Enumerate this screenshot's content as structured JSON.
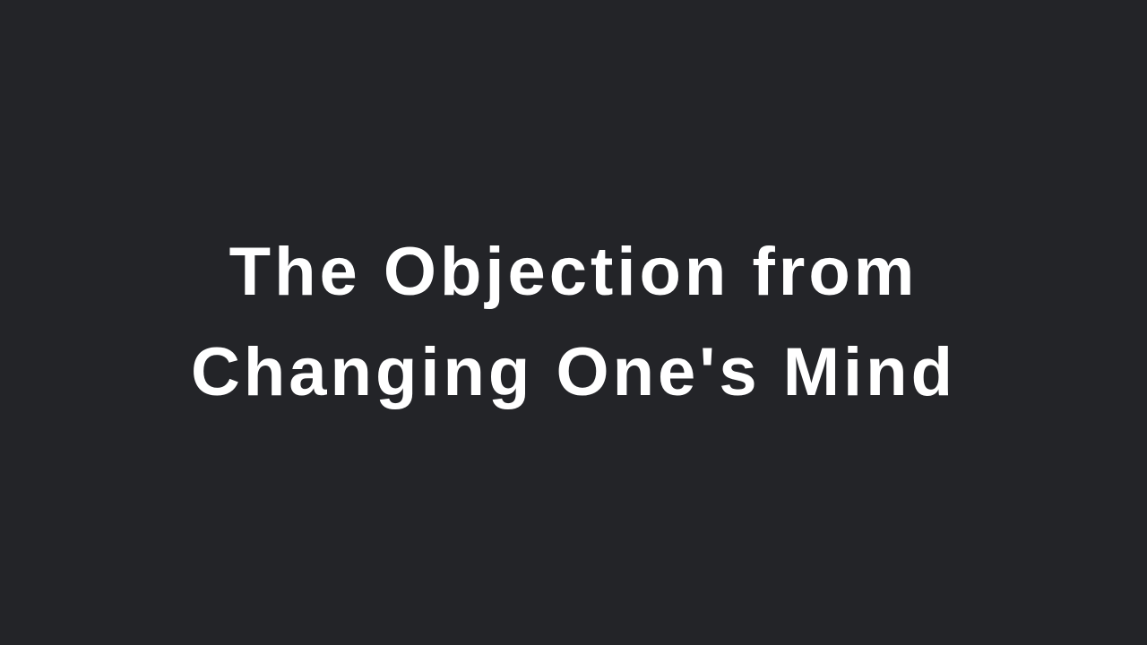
{
  "slide": {
    "title_lines": [
      "The Objection from",
      "Changing One's Mind"
    ]
  },
  "colors": {
    "background": "#232428",
    "text": "#ffffff"
  }
}
